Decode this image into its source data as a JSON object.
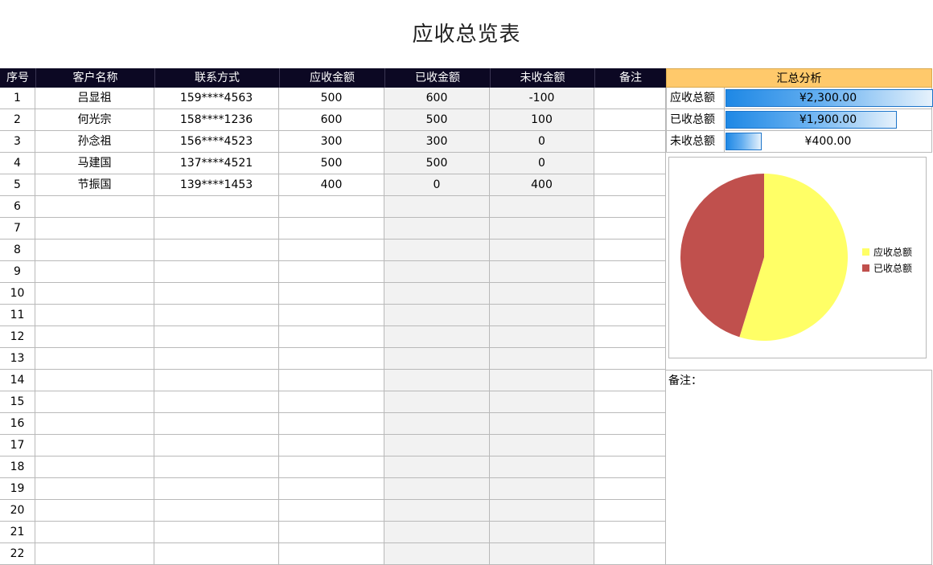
{
  "title": "应收总览表",
  "table": {
    "headers": [
      "序号",
      "客户名称",
      "联系方式",
      "应收金额",
      "已收金额",
      "未收金额",
      "备注"
    ],
    "rows": [
      [
        "1",
        "吕显祖",
        "159****4563",
        "500",
        "600",
        "-100",
        ""
      ],
      [
        "2",
        "何光宗",
        "158****1236",
        "600",
        "500",
        "100",
        ""
      ],
      [
        "3",
        "孙念祖",
        "156****4523",
        "300",
        "300",
        "0",
        ""
      ],
      [
        "4",
        "马建国",
        "137****4521",
        "500",
        "500",
        "0",
        ""
      ],
      [
        "5",
        "节振国",
        "139****1453",
        "400",
        "0",
        "400",
        ""
      ],
      [
        "6",
        "",
        "",
        "",
        "",
        "",
        ""
      ],
      [
        "7",
        "",
        "",
        "",
        "",
        "",
        ""
      ],
      [
        "8",
        "",
        "",
        "",
        "",
        "",
        ""
      ],
      [
        "9",
        "",
        "",
        "",
        "",
        "",
        ""
      ],
      [
        "10",
        "",
        "",
        "",
        "",
        "",
        ""
      ],
      [
        "11",
        "",
        "",
        "",
        "",
        "",
        ""
      ],
      [
        "12",
        "",
        "",
        "",
        "",
        "",
        ""
      ],
      [
        "13",
        "",
        "",
        "",
        "",
        "",
        ""
      ],
      [
        "14",
        "",
        "",
        "",
        "",
        "",
        ""
      ],
      [
        "15",
        "",
        "",
        "",
        "",
        "",
        ""
      ],
      [
        "16",
        "",
        "",
        "",
        "",
        "",
        ""
      ],
      [
        "17",
        "",
        "",
        "",
        "",
        "",
        ""
      ],
      [
        "18",
        "",
        "",
        "",
        "",
        "",
        ""
      ],
      [
        "19",
        "",
        "",
        "",
        "",
        "",
        ""
      ],
      [
        "20",
        "",
        "",
        "",
        "",
        "",
        ""
      ],
      [
        "21",
        "",
        "",
        "",
        "",
        "",
        ""
      ],
      [
        "22",
        "",
        "",
        "",
        "",
        "",
        ""
      ]
    ]
  },
  "summary": {
    "header": "汇总分析",
    "items": [
      {
        "label": "应收总额",
        "value": "¥2,300.00",
        "fill": 1.0
      },
      {
        "label": "已收总额",
        "value": "¥1,900.00",
        "fill": 0.826
      },
      {
        "label": "未收总额",
        "value": "¥400.00",
        "fill": 0.174
      }
    ]
  },
  "chart_data": {
    "type": "pie",
    "labels": [
      "应收总额",
      "已收总额"
    ],
    "values": [
      2300,
      1900
    ],
    "colors": [
      "#ffff66",
      "#c0504d"
    ],
    "legend_position": "right"
  },
  "notes": {
    "label": "备注："
  }
}
